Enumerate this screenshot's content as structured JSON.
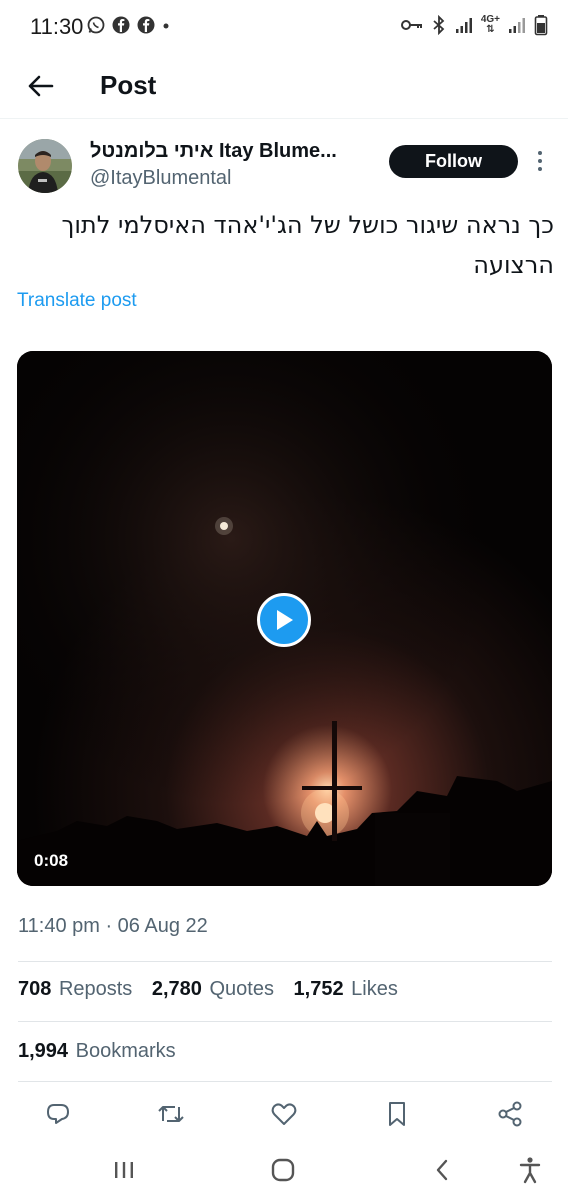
{
  "status_bar": {
    "time": "11:30",
    "left_icons": [
      "whatsapp-icon",
      "facebook-icon",
      "facebook-icon",
      "notification-dot-icon"
    ],
    "right_icons": [
      "key-icon",
      "bluetooth-icon",
      "signal-icon",
      "network-4g-icon",
      "signal-icon",
      "battery-icon"
    ],
    "network_label": "4G+"
  },
  "header": {
    "title": "Post"
  },
  "author": {
    "display_name": "איתי בלומנטל Itay Blume...",
    "handle": "@ItayBlumental",
    "follow_label": "Follow"
  },
  "post": {
    "text_line1": "כך נראה שיגור כושל של הג'י'אהד האיסלמי לתוך",
    "text_line2": "הרצועה",
    "translate_label": "Translate post",
    "video_duration": "0:08",
    "timestamp": "11:40 pm · 06 Aug 22"
  },
  "stats": {
    "reposts_count": "708",
    "reposts_label": "Reposts",
    "quotes_count": "2,780",
    "quotes_label": "Quotes",
    "likes_count": "1,752",
    "likes_label": "Likes",
    "bookmarks_count": "1,994",
    "bookmarks_label": "Bookmarks"
  },
  "actions": [
    "reply-icon",
    "repost-icon",
    "like-icon",
    "bookmark-icon",
    "share-icon"
  ],
  "nav_bar": [
    "recent-apps-icon",
    "home-icon",
    "back-icon",
    "accessibility-icon"
  ],
  "colors": {
    "accent": "#1d9bf0",
    "text_primary": "#0f1419",
    "text_secondary": "#536471",
    "follow_bg": "#0f1419"
  }
}
